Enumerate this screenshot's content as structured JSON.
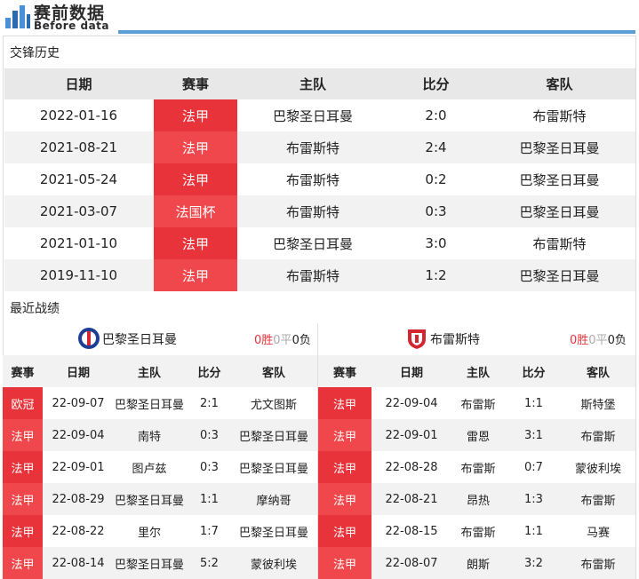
{
  "brand": {
    "title": "赛前数据",
    "subtitle": "Before data",
    "accent": "#5a9fd4"
  },
  "h2h": {
    "title": "交锋历史",
    "headers": {
      "date": "日期",
      "comp": "赛事",
      "home": "主队",
      "score": "比分",
      "away": "客队"
    },
    "rows": [
      {
        "date": "2022-01-16",
        "comp": "法甲",
        "home": "巴黎圣日耳曼",
        "score": "2:0",
        "away": "布雷斯特"
      },
      {
        "date": "2021-08-21",
        "comp": "法甲",
        "home": "布雷斯特",
        "score": "2:4",
        "away": "巴黎圣日耳曼"
      },
      {
        "date": "2021-05-24",
        "comp": "法甲",
        "home": "布雷斯特",
        "score": "0:2",
        "away": "巴黎圣日耳曼"
      },
      {
        "date": "2021-03-07",
        "comp": "法国杯",
        "home": "布雷斯特",
        "score": "0:3",
        "away": "巴黎圣日耳曼"
      },
      {
        "date": "2021-01-10",
        "comp": "法甲",
        "home": "巴黎圣日耳曼",
        "score": "3:0",
        "away": "布雷斯特"
      },
      {
        "date": "2019-11-10",
        "comp": "法甲",
        "home": "布雷斯特",
        "score": "1:2",
        "away": "巴黎圣日耳曼"
      }
    ]
  },
  "recent": {
    "title": "最近战绩",
    "headers": {
      "comp": "赛事",
      "date": "日期",
      "home": "主队",
      "score": "比分",
      "away": "客队"
    },
    "left": {
      "team": "巴黎圣日耳曼",
      "record": {
        "w": "0胜",
        "d": "0平",
        "l": "0负"
      },
      "rows": [
        {
          "comp": "欧冠",
          "date": "22-09-07",
          "home": "巴黎圣日耳曼",
          "score": "2:1",
          "away": "尤文图斯"
        },
        {
          "comp": "法甲",
          "date": "22-09-04",
          "home": "南特",
          "score": "0:3",
          "away": "巴黎圣日耳曼"
        },
        {
          "comp": "法甲",
          "date": "22-09-01",
          "home": "图卢兹",
          "score": "0:3",
          "away": "巴黎圣日耳曼"
        },
        {
          "comp": "法甲",
          "date": "22-08-29",
          "home": "巴黎圣日耳曼",
          "score": "1:1",
          "away": "摩纳哥"
        },
        {
          "comp": "法甲",
          "date": "22-08-22",
          "home": "里尔",
          "score": "1:7",
          "away": "巴黎圣日耳曼"
        },
        {
          "comp": "法甲",
          "date": "22-08-14",
          "home": "巴黎圣日耳曼",
          "score": "5:2",
          "away": "蒙彼利埃"
        }
      ]
    },
    "right": {
      "team": "布雷斯特",
      "record": {
        "w": "0胜",
        "d": "0平",
        "l": "0负"
      },
      "rows": [
        {
          "comp": "法甲",
          "date": "22-09-04",
          "home": "布雷斯",
          "score": "1:1",
          "away": "斯特堡"
        },
        {
          "comp": "法甲",
          "date": "22-09-01",
          "home": "雷恩",
          "score": "3:1",
          "away": "布雷斯"
        },
        {
          "comp": "法甲",
          "date": "22-08-28",
          "home": "布雷斯",
          "score": "0:7",
          "away": "蒙彼利埃"
        },
        {
          "comp": "法甲",
          "date": "22-08-21",
          "home": "昂热",
          "score": "1:3",
          "away": "布雷斯"
        },
        {
          "comp": "法甲",
          "date": "22-08-15",
          "home": "布雷斯",
          "score": "1:1",
          "away": "马赛"
        },
        {
          "comp": "法甲",
          "date": "22-08-07",
          "home": "朗斯",
          "score": "3:2",
          "away": "布雷斯"
        }
      ]
    }
  }
}
